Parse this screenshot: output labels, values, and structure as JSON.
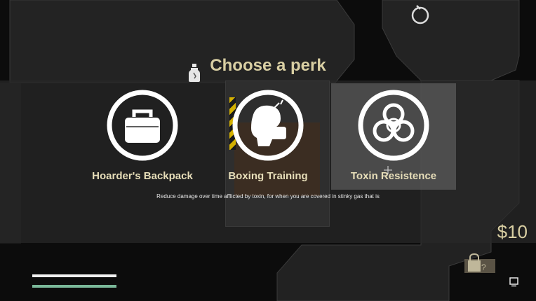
{
  "title": "Choose a perk",
  "perks": [
    {
      "name": "Hoarder's Backpack",
      "icon": "backpack-icon",
      "selected": false
    },
    {
      "name": "Boxing Training",
      "icon": "boxing-glove-icon",
      "selected": false
    },
    {
      "name": "Toxin Resistence",
      "icon": "biohazard-icon",
      "selected": true
    }
  ],
  "description": "Reduce damage over time afflicted by toxin, for when you are covered in stinky gas that is",
  "hud": {
    "money": "$10"
  },
  "colors": {
    "title": "#d9cfa3",
    "health_bar": "#f0f0f0",
    "stamina_bar": "#7ab899"
  }
}
